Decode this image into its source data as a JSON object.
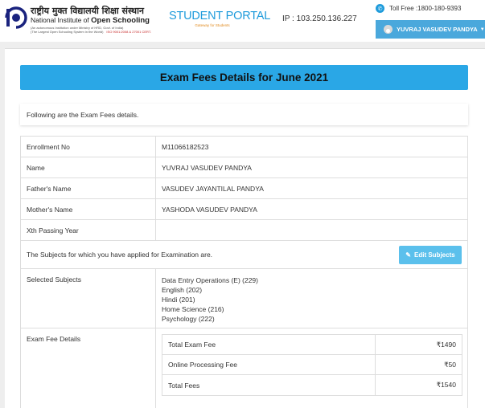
{
  "header": {
    "org_hindi": "राष्ट्रीय मुक्त विद्यालयी शिक्षा संस्थान",
    "org_english_prefix": "National Institute of ",
    "org_english_bold": "Open Schooling",
    "org_tagline_1": "(An autonomous Institution under Ministry of HRD, Govt. of India)",
    "org_tagline_2": "(The Largest Open Schooling System in the World)",
    "org_iso": "ISO 9001:2008 & 27001 CERT.",
    "portal_title": "STUDENT PORTAL",
    "portal_subtitle": "Gateway for Students",
    "ip_text": "IP : 103.250.136.227",
    "toll_free": "Toll Free :1800-180-9393",
    "user_name": "YUVRAJ VASUDEV PANDYA"
  },
  "page": {
    "title": "Exam Fees Details for June 2021",
    "info": "Following are the Exam Fees details."
  },
  "details": {
    "enrollment_label": "Enrollment No",
    "enrollment_value": "M11066182523",
    "name_label": "Name",
    "name_value": "YUVRAJ VASUDEV PANDYA",
    "father_label": "Father's Name",
    "father_value": "VASUDEV JAYANTILAL PANDYA",
    "mother_label": "Mother's Name",
    "mother_value": "YASHODA VASUDEV PANDYA",
    "xth_label": "Xth Passing Year",
    "xth_value": "",
    "subjects_note": "The Subjects for which you have applied for Examination are.",
    "edit_subjects_label": "Edit Subjects",
    "selected_subjects_label": "Selected Subjects",
    "selected_subjects": [
      "Data Entry Operations (E) (229)",
      "English (202)",
      "Hindi (201)",
      "Home Science (216)",
      "Psychology (222)"
    ],
    "exam_fee_label": "Exam Fee Details",
    "fees": [
      {
        "name": "Total Exam Fee",
        "amount": "₹1490"
      },
      {
        "name": "Online Processing Fee",
        "amount": "₹50"
      },
      {
        "name": "Total Fees",
        "amount": "₹1540"
      }
    ]
  },
  "colors": {
    "accent": "#2aa7e6",
    "user_bar": "#4aa8dc",
    "edit_button": "#5bc0ec"
  },
  "icons": [
    "nios-logo-icon",
    "phone-icon",
    "user-avatar-icon",
    "caret-down-icon",
    "pencil-icon"
  ]
}
